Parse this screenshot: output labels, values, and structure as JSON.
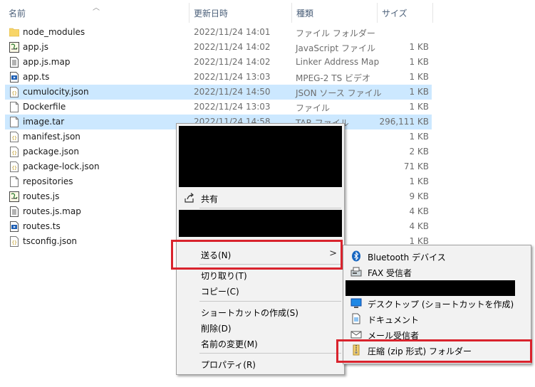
{
  "columns": {
    "name": "名前",
    "modified": "更新日時",
    "type": "種類",
    "size": "サイズ"
  },
  "files": [
    {
      "name": "node_modules",
      "modified": "2022/11/24 14:01",
      "type": "ファイル フォルダー",
      "size": "",
      "icon": "folder-icon",
      "selected": false
    },
    {
      "name": "app.js",
      "modified": "2022/11/24 14:02",
      "type": "JavaScript ファイル",
      "size": "1 KB",
      "icon": "script-icon",
      "selected": false
    },
    {
      "name": "app.js.map",
      "modified": "2022/11/24 14:02",
      "type": "Linker Address Map",
      "size": "1 KB",
      "icon": "document-icon",
      "selected": false
    },
    {
      "name": "app.ts",
      "modified": "2022/11/24 13:03",
      "type": "MPEG-2 TS ビデオ",
      "size": "1 KB",
      "icon": "video-file-icon",
      "selected": false
    },
    {
      "name": "cumulocity.json",
      "modified": "2022/11/24 14:50",
      "type": "JSON ソース ファイル",
      "size": "1 KB",
      "icon": "json-file-icon",
      "selected": true
    },
    {
      "name": "Dockerfile",
      "modified": "2022/11/24 13:03",
      "type": "ファイル",
      "size": "1 KB",
      "icon": "blank-file-icon",
      "selected": false
    },
    {
      "name": "image.tar",
      "modified": "2022/11/24 14:58",
      "type": "TAR ファイル",
      "size": "296,111 KB",
      "icon": "blank-file-icon",
      "selected": true
    },
    {
      "name": "manifest.json",
      "modified": "",
      "type": "ァイル",
      "size": "1 KB",
      "icon": "json-file-icon",
      "selected": false
    },
    {
      "name": "package.json",
      "modified": "",
      "type": "ァイル",
      "size": "2 KB",
      "icon": "json-file-icon",
      "selected": false
    },
    {
      "name": "package-lock.json",
      "modified": "",
      "type": "ァイル",
      "size": "71 KB",
      "icon": "json-file-icon",
      "selected": false
    },
    {
      "name": "repositories",
      "modified": "",
      "type": "",
      "size": "1 KB",
      "icon": "blank-file-icon",
      "selected": false
    },
    {
      "name": "routes.js",
      "modified": "",
      "type": "イル",
      "size": "9 KB",
      "icon": "script-icon",
      "selected": false
    },
    {
      "name": "routes.js.map",
      "modified": "",
      "type": "ss Map",
      "size": "4 KB",
      "icon": "document-icon",
      "selected": false
    },
    {
      "name": "routes.ts",
      "modified": "",
      "type": "デオ",
      "size": "4 KB",
      "icon": "video-file-icon",
      "selected": false
    },
    {
      "name": "tsconfig.json",
      "modified": "",
      "type": "イル",
      "size": "1 KB",
      "icon": "json-file-icon",
      "selected": false
    }
  ],
  "context_menu": {
    "share": "共有",
    "send_to": "送る(N)",
    "cut": "切り取り(T)",
    "copy": "コピー(C)",
    "create_shortcut": "ショートカットの作成(S)",
    "delete": "削除(D)",
    "rename": "名前の変更(M)",
    "properties": "プロパティ(R)"
  },
  "send_to_menu": {
    "bluetooth": "Bluetooth デバイス",
    "fax": "FAX 受信者",
    "desktop": "デスクトップ (ショートカットを作成)",
    "documents": "ドキュメント",
    "mail": "メール受信者",
    "zip": "圧縮 (zip 形式) フォルダー"
  },
  "colors": {
    "selection": "#cce8ff",
    "highlight_box": "#d9232d",
    "menu_bg": "#f2f2f2"
  }
}
